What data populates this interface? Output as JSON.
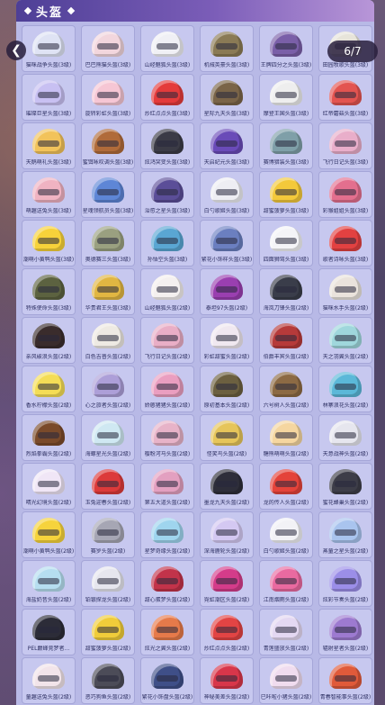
{
  "panel": {
    "title": "头盔"
  },
  "viewer": {
    "counter": "6/7"
  },
  "icons": {
    "back": "chevron-left-icon",
    "title_decor": "diamond-icon"
  },
  "helmets": [
    {
      "label": "猫咪战争头盔(3级)",
      "color": "#dfe3f4"
    },
    {
      "label": "巴巴熊猫头盔(3级)",
      "color": "#f2d6dd"
    },
    {
      "label": "山经魅狐头盔(3级)",
      "color": "#f0f0f5"
    },
    {
      "label": "机械英豪头盔(3级)",
      "color": "#8a7a55"
    },
    {
      "label": "王牌四分之头盔(3级)",
      "color": "#7a5fa8"
    },
    {
      "label": "田园牧歌头盔(3级)",
      "color": "#e7e4da"
    },
    {
      "label": "璀璨巨星头盔(3级)",
      "color": "#c8c0f2"
    },
    {
      "label": "旋转彩虹头盔(3级)",
      "color": "#f6c6d4"
    },
    {
      "label": "炒红点点头盔(3级)",
      "color": "#e43b3b"
    },
    {
      "label": "星际九天头盔(3级)",
      "color": "#7a6448"
    },
    {
      "label": "摩登王国头盔(3级)",
      "color": "#eeeeee"
    },
    {
      "label": "红帝蘑菇头盔(3级)",
      "color": "#e35450"
    },
    {
      "label": "天鹅萌礼头盔(3级)",
      "color": "#f2c35b"
    },
    {
      "label": "蜜饵咏叹调头盔(3级)",
      "color": "#b06b3a"
    },
    {
      "label": "炫鸿突变头盔(3级)",
      "color": "#3b3b46"
    },
    {
      "label": "天启纪元头盔(3级)",
      "color": "#6a4bb8"
    },
    {
      "label": "赛博猎装头盔(3级)",
      "color": "#7f9fa8"
    },
    {
      "label": "飞行日记头盔(3级)",
      "color": "#e9aeca"
    },
    {
      "label": "萌趣送兔头盔(3级)",
      "color": "#f0b3c2"
    },
    {
      "label": "星魂领航员头盔(3级)",
      "color": "#5e86d6"
    },
    {
      "label": "治愈之星头盔(3级)",
      "color": "#5b4e98"
    },
    {
      "label": "白勺歌姬头盔(3级)",
      "color": "#eeeef3"
    },
    {
      "label": "甜蜜菠萝头盔(3级)",
      "color": "#f3c93b"
    },
    {
      "label": "彩猴姐姐头盔(3级)",
      "color": "#e36f8e"
    },
    {
      "label": "潮萌小黄鸭头盔(3级)",
      "color": "#f7d23a"
    },
    {
      "label": "奥德赛三头盔(3级)",
      "color": "#9aa080"
    },
    {
      "label": "孙悟空头盔(3级)",
      "color": "#5aa6d3"
    },
    {
      "label": "繁花小饰样头盔(3级)",
      "color": "#6b7fc0"
    },
    {
      "label": "四面狮驾头盔(3级)",
      "color": "#f4f4f7"
    },
    {
      "label": "歌者诗咏头盔(3级)",
      "color": "#e24141"
    },
    {
      "label": "特殊使命头盔(3级)",
      "color": "#5c6240"
    },
    {
      "label": "华贵君王头盔(3级)",
      "color": "#e1b642"
    },
    {
      "label": "山经魅狐头盔(2级)",
      "color": "#f4f0ef"
    },
    {
      "label": "泰坦97头盔(2级)",
      "color": "#9a3fb0"
    },
    {
      "label": "海岚刀锋头盔(2级)",
      "color": "#3a3d4a"
    },
    {
      "label": "猫咪水手头盔(2级)",
      "color": "#eae3dc"
    },
    {
      "label": "亲风破浪头盔(2级)",
      "color": "#3a2c2c"
    },
    {
      "label": "白色吉普头盔(2级)",
      "color": "#eeeae3"
    },
    {
      "label": "飞行日记头盔(2级)",
      "color": "#e9aec6"
    },
    {
      "label": "彩虹甜蜜头盔(2级)",
      "color": "#f0e8f0"
    },
    {
      "label": "伯爵丰宾头盔(2级)",
      "color": "#b63a3a"
    },
    {
      "label": "天之羽翼头盔(2级)",
      "color": "#9fd7dc"
    },
    {
      "label": "香水柠檬头盔(2级)",
      "color": "#f4dd56"
    },
    {
      "label": "心之旅者头盔(2级)",
      "color": "#ad9fd8"
    },
    {
      "label": "娇憨猪猪头盔(2级)",
      "color": "#ea9ec0"
    },
    {
      "label": "原初基本头盔(2级)",
      "color": "#6c6040"
    },
    {
      "label": "六号树人头盔(2级)",
      "color": "#8c6a44"
    },
    {
      "label": "林寨浪花头盔(2级)",
      "color": "#5bb8d8"
    },
    {
      "label": "烈焰拳霸头盔(2级)",
      "color": "#7a4a2a"
    },
    {
      "label": "海螺星光头盔(2级)",
      "color": "#cfe8f2"
    },
    {
      "label": "樱粉河马头盔(2级)",
      "color": "#e7b3c8"
    },
    {
      "label": "怪笑鸟头盔(2级)",
      "color": "#e6c55a"
    },
    {
      "label": "糖熊萌萌头盔(2级)",
      "color": "#f5d6a0"
    },
    {
      "label": "天意战神头盔(2级)",
      "color": "#e6e6ee"
    },
    {
      "label": "晴光幻境头盔(2级)",
      "color": "#f0e6f6"
    },
    {
      "label": "玉兔迎春头盔(2级)",
      "color": "#dc3a3a"
    },
    {
      "label": "第五大道头盔(2级)",
      "color": "#e3a0c0"
    },
    {
      "label": "墨龙九天头盔(2级)",
      "color": "#2e2e3a"
    },
    {
      "label": "龙的传人头盔(2级)",
      "color": "#e4433a"
    },
    {
      "label": "蜜花蜂巢头盔(2级)",
      "color": "#3d3d48"
    },
    {
      "label": "潮萌小黄鸭头盔(2级)",
      "color": "#f6d33c"
    },
    {
      "label": "赛罗头盔(2级)",
      "color": "#a6a6b4"
    },
    {
      "label": "星梦奇缘头盔(2级)",
      "color": "#9fd5ee"
    },
    {
      "label": "深海鹿轮头盔(2级)",
      "color": "#d4c8f2"
    },
    {
      "label": "白勺歌姬头盔(2级)",
      "color": "#f2f2f6"
    },
    {
      "label": "蒸童之星头盔(2级)",
      "color": "#a9c4ee"
    },
    {
      "label": "海盐奶昔头盔(2级)",
      "color": "#b6def0"
    },
    {
      "label": "铂银探龙头盔(2级)",
      "color": "#e6e6ee"
    },
    {
      "label": "甜心蛋梦头盔(2级)",
      "color": "#c2334a"
    },
    {
      "label": "霓虹潮区头盔(2级)",
      "color": "#d43c8a"
    },
    {
      "label": "江南烟雨头盔(2级)",
      "color": "#e96aa0"
    },
    {
      "label": "炫彩节奏头盔(2级)",
      "color": "#9b8ee8"
    },
    {
      "label": "PEL巅峰竞梦者...",
      "color": "#2c2c38"
    },
    {
      "label": "甜蜜菠萝头盔(2级)",
      "color": "#f0cc3a"
    },
    {
      "label": "炫光之翼头盔(2级)",
      "color": "#e67a4a"
    },
    {
      "label": "炒红点点头盔(2级)",
      "color": "#e24444"
    },
    {
      "label": "青莲盛放头盔(2级)",
      "color": "#e4d8f2"
    },
    {
      "label": "辐射星者头盔(2级)",
      "color": "#9d7ad0"
    },
    {
      "label": "童趣送兔头盔(2级)",
      "color": "#f2e4ea"
    },
    {
      "label": "恶巧狗鱼头盔(2级)",
      "color": "#4c4c58"
    },
    {
      "label": "繁花小饰盘头盔(2级)",
      "color": "#3f4f88"
    },
    {
      "label": "神秘美差头盔(2级)",
      "color": "#d8364a"
    },
    {
      "label": "已咔啦小猪头盔(2级)",
      "color": "#f0dcef"
    },
    {
      "label": "青春智能事头盔(2级)",
      "color": "#e05a3a"
    }
  ]
}
